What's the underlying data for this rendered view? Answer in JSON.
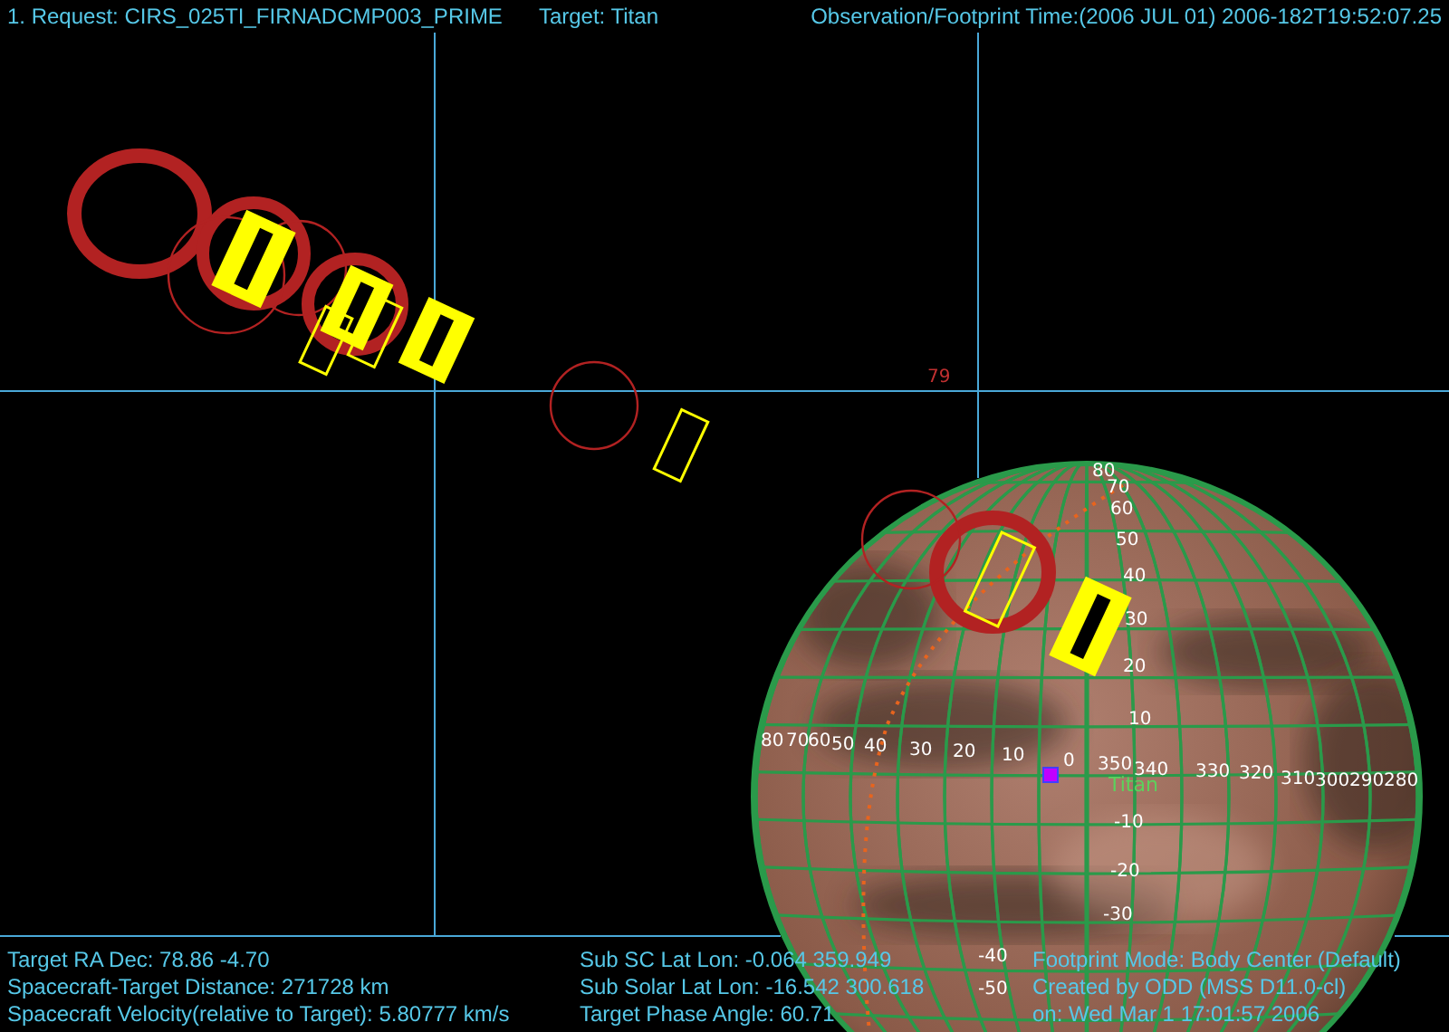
{
  "header": {
    "request": "1. Request: CIRS_025TI_FIRNADCMP003_PRIME",
    "target": "Target: Titan",
    "time": "Observation/Footprint Time:(2006 JUL 01) 2006-182T19:52:07.25"
  },
  "plot": {
    "grid_label": "79",
    "body_label": "Titan",
    "latitude_labels": [
      "80",
      "70",
      "60",
      "50",
      "40",
      "30",
      "20",
      "10",
      "-10",
      "-20",
      "-30",
      "-40",
      "-50"
    ],
    "longitude_labels": [
      "80",
      "70",
      "60",
      "50",
      "40",
      "30",
      "20",
      "10",
      "0",
      "350",
      "340",
      "330",
      "320",
      "310",
      "300",
      "290",
      "280"
    ]
  },
  "footer": {
    "left": [
      "Target RA Dec: 78.86  -4.70",
      "Spacecraft-Target Distance:  271728 km",
      "Spacecraft Velocity(relative to Target): 5.80777 km/s"
    ],
    "middle": [
      "Sub SC Lat Lon: -0.064  359.949",
      "Sub Solar Lat Lon: -16.542  300.618",
      "Target Phase Angle: 60.71"
    ],
    "right": [
      "Footprint Mode: Body Center (Default)",
      "Created by ODD (MSS D11.0-cl)",
      "on: Wed Mar  1 17:01:57 2006"
    ]
  }
}
